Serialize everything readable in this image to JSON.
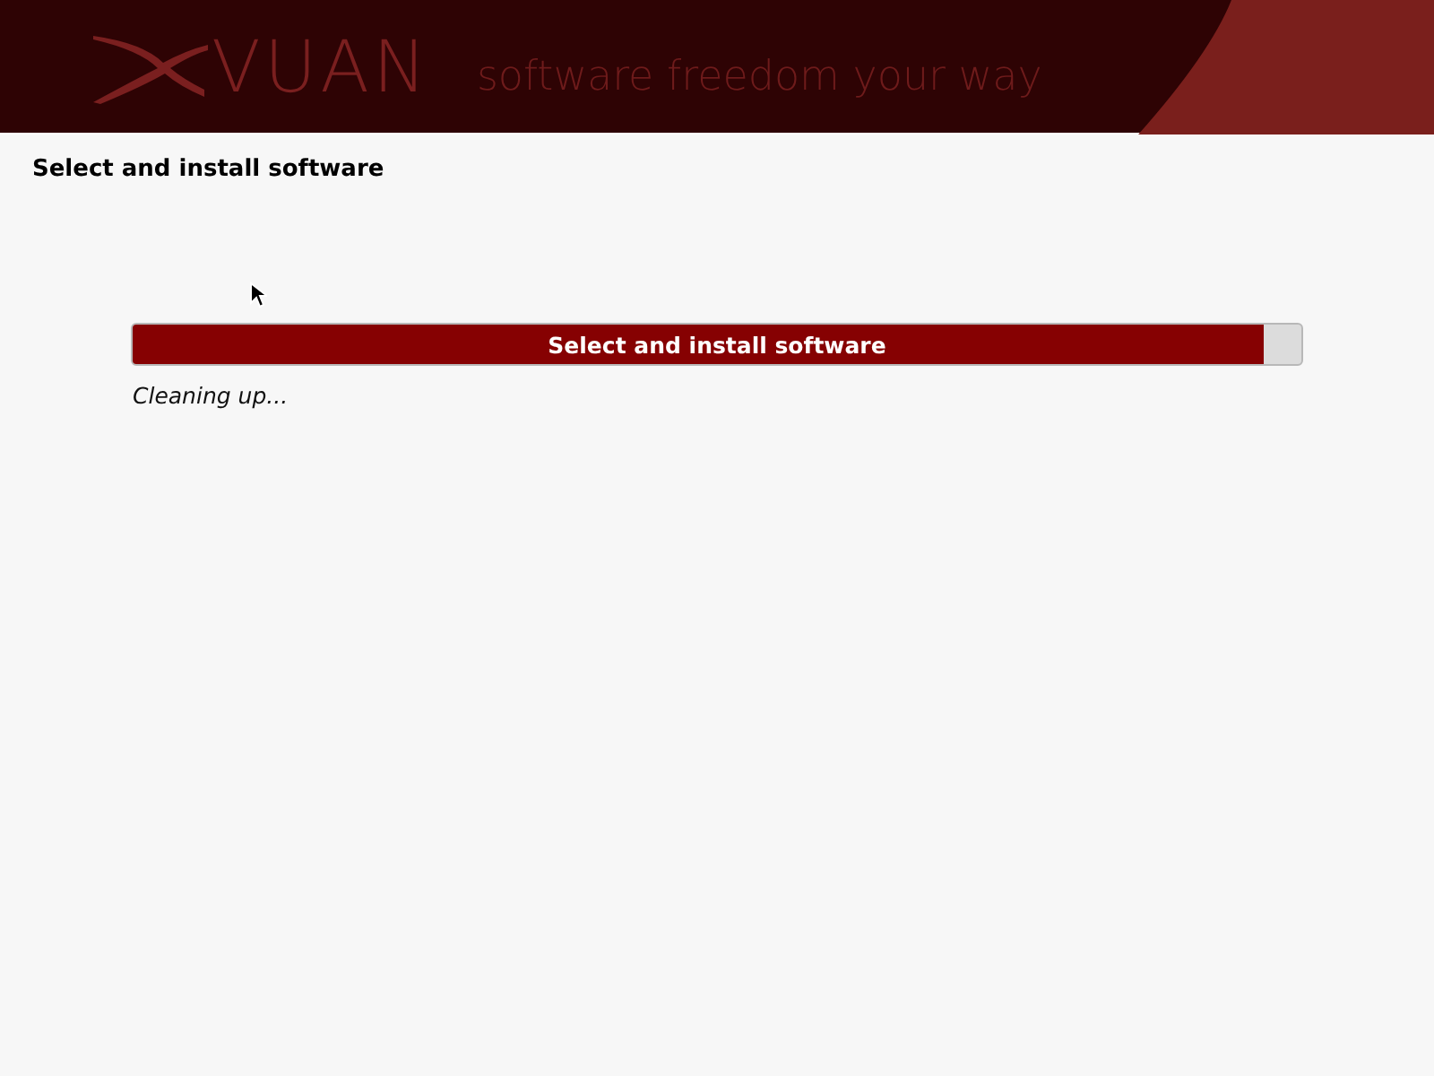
{
  "banner": {
    "logo": "VUAN",
    "tagline": "software freedom your way"
  },
  "page_title": "Select and install software",
  "progress": {
    "label": "Select and install software",
    "level": 0.968,
    "status": "Cleaning up..."
  }
}
